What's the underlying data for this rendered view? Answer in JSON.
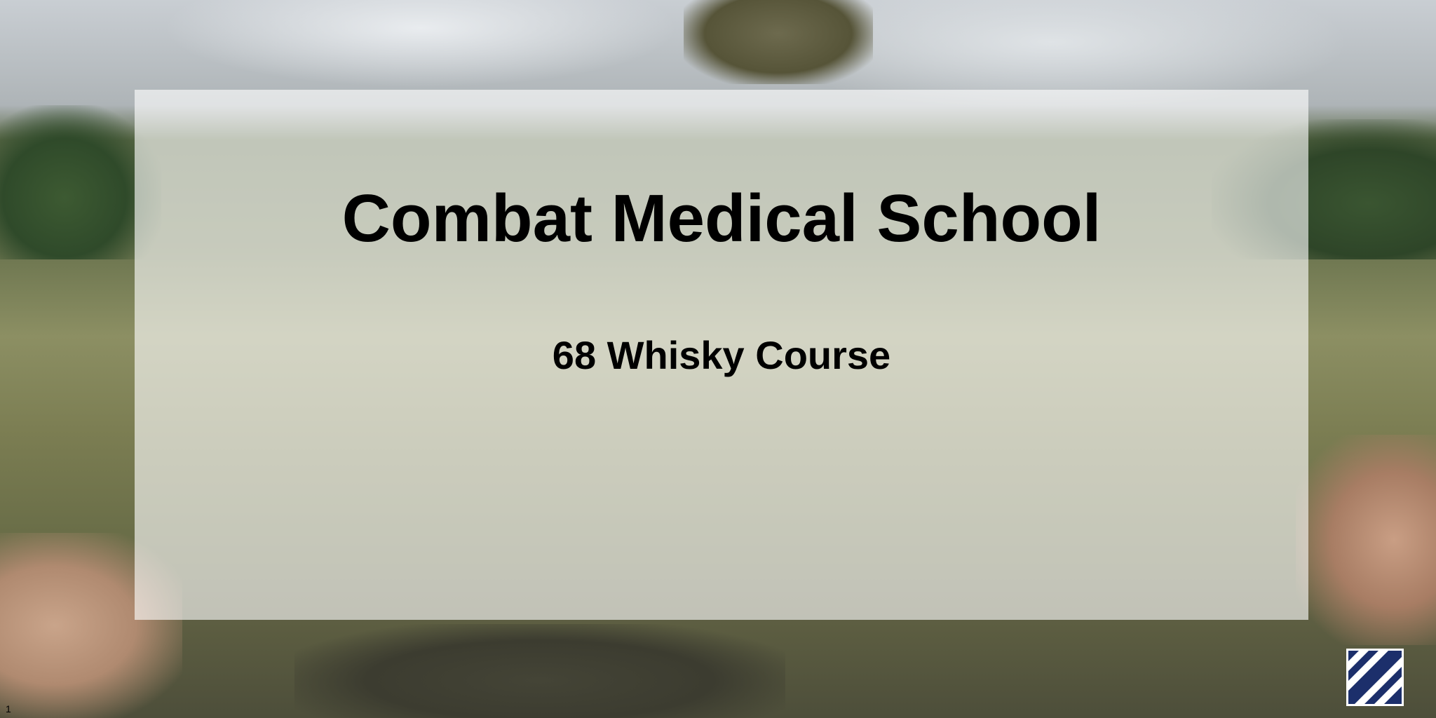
{
  "slide": {
    "title": "Combat Medical School",
    "subtitle": "68 Whisky Course",
    "slide_number": "1"
  },
  "insignia": {
    "icon": "third-infantry-division-patch-icon",
    "colors": {
      "background": "#1c2f6b",
      "stripes": "#ffffff"
    }
  },
  "colors": {
    "overlay": "#ffffff",
    "text": "#000000"
  }
}
